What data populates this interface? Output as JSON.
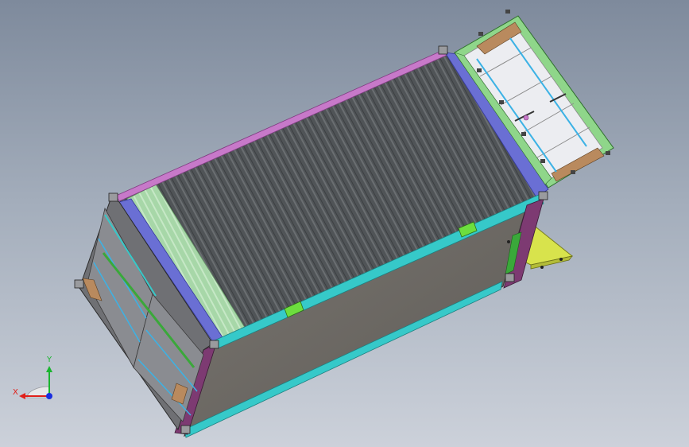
{
  "triad": {
    "x_label": "X",
    "y_label": "Y"
  },
  "colors": {
    "roof": "#4d5154",
    "side_wall": "#6e6b68",
    "top_rail": "#c779c9",
    "end_beam": "#6a6fd4",
    "rail_cyan": "#36c9c9",
    "door_panel": "#ecedf1",
    "door_frame": "#8fd68a",
    "door_strip": "#b98a5e",
    "door_bar": "#3cb2e5",
    "end_panel": "#a3d8a5",
    "side_post": "#7d3a72",
    "corner_green": "#3aa83a",
    "ramp_yellow": "#d8e34c",
    "bracket_green": "#6dde3e",
    "axis_x": "#e0201a",
    "axis_y": "#1ab52f",
    "axis_z": "#1a2ee0"
  }
}
